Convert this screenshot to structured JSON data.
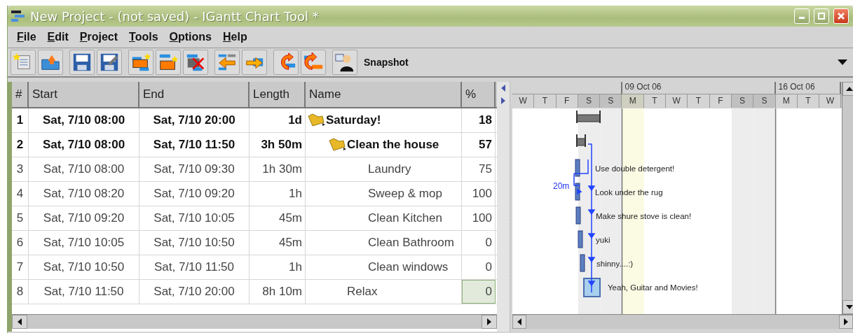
{
  "window": {
    "title": "New Project - (not saved) - IGantt Chart Tool *"
  },
  "menu": [
    "File",
    "Edit",
    "Project",
    "Tools",
    "Options",
    "Help"
  ],
  "toolbar": {
    "groups": [
      [
        {
          "kind": "new"
        },
        {
          "kind": "open"
        }
      ],
      [
        {
          "kind": "save"
        },
        {
          "kind": "save_as"
        }
      ],
      [
        {
          "kind": "new_task"
        },
        {
          "kind": "new_subtask"
        },
        {
          "kind": "delete"
        }
      ],
      [
        {
          "kind": "outdent"
        },
        {
          "kind": "indent"
        }
      ],
      [
        {
          "kind": "link"
        },
        {
          "kind": "unlink"
        }
      ],
      [
        {
          "kind": "snapshot"
        }
      ]
    ],
    "snapshot_label": "Snapshot"
  },
  "table": {
    "columns": [
      "#",
      "Start",
      "End",
      "Length",
      "Name",
      "%"
    ],
    "tasks": [
      {
        "kind": "summary",
        "expanded": true,
        "number": "1",
        "start": "Sat, 7/10 08:00",
        "end": "Sat, 7/10 20:00",
        "length": "1d",
        "name": "Saturday!",
        "percent": "18",
        "selected": false,
        "children": [
          {
            "kind": "summary",
            "expanded": true,
            "number": "2",
            "start": "Sat, 7/10 08:00",
            "end": "Sat, 7/10 11:50",
            "length": "3h 50m",
            "name": "Clean the house",
            "percent": "57",
            "selected": false,
            "children": [
              {
                "kind": "task",
                "number": "3",
                "start": "Sat, 7/10 08:00",
                "end": "Sat, 7/10 09:30",
                "length": "1h 30m",
                "name": "Laundry",
                "percent": "75",
                "selected": false,
                "note": "Use double detergent!"
              },
              {
                "kind": "task",
                "number": "4",
                "start": "Sat, 7/10 08:20",
                "end": "Sat, 7/10 09:20",
                "length": "1h",
                "name": "Sweep & mop",
                "percent": "100",
                "selected": false,
                "note": "Look under the rug",
                "lag": "20m"
              },
              {
                "kind": "task",
                "number": "5",
                "start": "Sat, 7/10 09:20",
                "end": "Sat, 7/10 10:05",
                "length": "45m",
                "name": "Clean Kitchen",
                "percent": "100",
                "selected": false,
                "note": "Make shure stove is clean!"
              },
              {
                "kind": "task",
                "number": "6",
                "start": "Sat, 7/10 10:05",
                "end": "Sat, 7/10 10:50",
                "length": "45m",
                "name": "Clean Bathroom",
                "percent": "0",
                "selected": false,
                "note": "yuki"
              },
              {
                "kind": "task",
                "number": "7",
                "start": "Sat, 7/10 10:50",
                "end": "Sat, 7/10 11:50",
                "length": "1h",
                "name": "Clean windows",
                "percent": "0",
                "selected": false,
                "note": "shinny....:)"
              }
            ]
          },
          {
            "kind": "task",
            "number": "8",
            "start": "Sat, 7/10 11:50",
            "end": "Sat, 7/10 20:00",
            "length": "8h 10m",
            "name": "Relax",
            "percent": "0",
            "selected": true,
            "note": "Yeah, Guitar and Movies!"
          }
        ]
      }
    ]
  },
  "gantt": {
    "weeks": [
      {
        "days": [
          {
            "label": "W",
            "weekend": false,
            "today": false
          },
          {
            "label": "T",
            "weekend": false,
            "today": false
          },
          {
            "label": "F",
            "weekend": false,
            "today": false
          },
          {
            "label": "S",
            "weekend": true,
            "today": false
          },
          {
            "label": "S",
            "weekend": true,
            "today": false
          }
        ]
      },
      {
        "label": "09 Oct 06",
        "days": [
          {
            "label": "M",
            "weekend": false,
            "today": true
          },
          {
            "label": "T",
            "weekend": false,
            "today": false
          },
          {
            "label": "W",
            "weekend": false,
            "today": false
          },
          {
            "label": "T",
            "weekend": false,
            "today": false
          },
          {
            "label": "F",
            "weekend": false,
            "today": false
          },
          {
            "label": "S",
            "weekend": true,
            "today": false
          },
          {
            "label": "S",
            "weekend": true,
            "today": false
          }
        ]
      },
      {
        "label": "16 Oct 06",
        "days": [
          {
            "label": "M",
            "weekend": false,
            "today": false
          },
          {
            "label": "T",
            "weekend": false,
            "today": false
          },
          {
            "label": "W",
            "weekend": false,
            "today": false
          }
        ]
      }
    ]
  }
}
